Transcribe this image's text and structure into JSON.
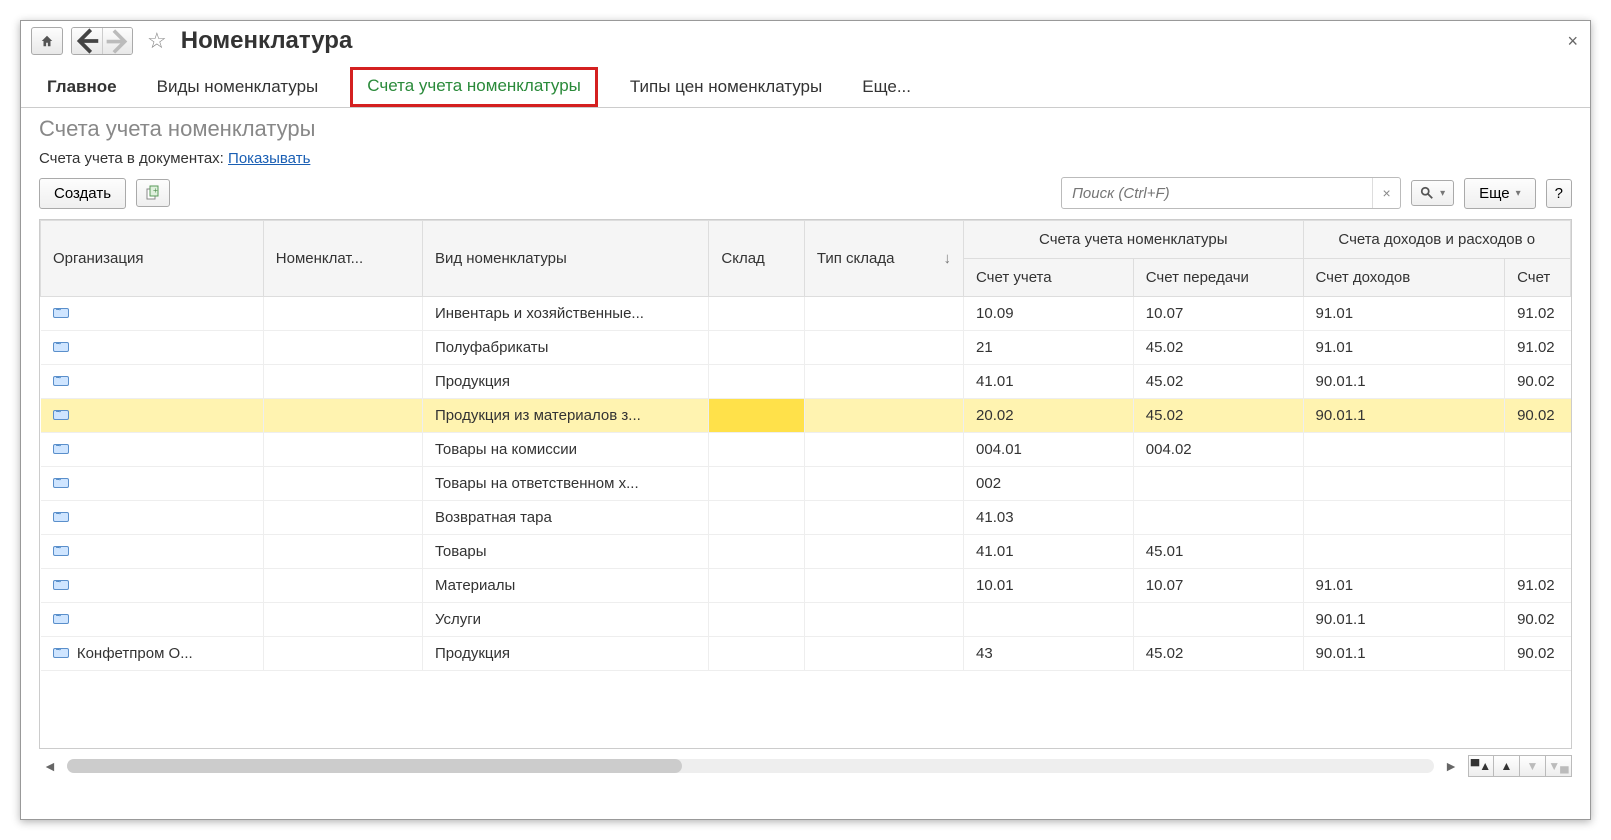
{
  "title": "Номенклатура",
  "tabs": {
    "main": "Главное",
    "types": "Виды номенклатуры",
    "accounts": "Счета учета номенклатуры",
    "price_types": "Типы цен номенклатуры",
    "more": "Еще..."
  },
  "subtitle": "Счета учета номенклатуры",
  "doc_info_label": "Счета учета в документах: ",
  "doc_info_link": "Показывать",
  "toolbar": {
    "create": "Создать",
    "search_placeholder": "Поиск (Ctrl+F)",
    "more": "Еще",
    "help": "?"
  },
  "columns": {
    "org": "Организация",
    "nomen": "Номенклат...",
    "type": "Вид номенклатуры",
    "ware": "Склад",
    "ware_type": "Тип склада",
    "acc_group": "Счета учета номенклатуры",
    "acc_balance": "Счет учета",
    "acc_transfer": "Счет передачи",
    "income_group": "Счета доходов и расходов о",
    "acc_income": "Счет доходов",
    "acc_partial": "Счет"
  },
  "rows": [
    {
      "org": "",
      "type": "Инвентарь и хозяйственные...",
      "acc": "10.09",
      "transfer": "10.07",
      "income": "91.01",
      "expense": "91.02"
    },
    {
      "org": "",
      "type": "Полуфабрикаты",
      "acc": "21",
      "transfer": "45.02",
      "income": "91.01",
      "expense": "91.02"
    },
    {
      "org": "",
      "type": "Продукция",
      "acc": "41.01",
      "transfer": "45.02",
      "income": "90.01.1",
      "expense": "90.02"
    },
    {
      "org": "",
      "type": "Продукция из материалов з...",
      "acc": "20.02",
      "transfer": "45.02",
      "income": "90.01.1",
      "expense": "90.02",
      "highlighted": true
    },
    {
      "org": "",
      "type": "Товары на комиссии",
      "acc": "004.01",
      "transfer": "004.02",
      "income": "",
      "expense": ""
    },
    {
      "org": "",
      "type": "Товары на ответственном х...",
      "acc": "002",
      "transfer": "",
      "income": "",
      "expense": ""
    },
    {
      "org": "",
      "type": "Возвратная тара",
      "acc": "41.03",
      "transfer": "",
      "income": "",
      "expense": ""
    },
    {
      "org": "",
      "type": "Товары",
      "acc": "41.01",
      "transfer": "45.01",
      "income": "",
      "expense": ""
    },
    {
      "org": "",
      "type": "Материалы",
      "acc": "10.01",
      "transfer": "10.07",
      "income": "91.01",
      "expense": "91.02"
    },
    {
      "org": "",
      "type": "Услуги",
      "acc": "",
      "transfer": "",
      "income": "90.01.1",
      "expense": "90.02"
    },
    {
      "org": "Конфетпром О...",
      "type": "Продукция",
      "acc": "43",
      "transfer": "45.02",
      "income": "90.01.1",
      "expense": "90.02"
    }
  ]
}
